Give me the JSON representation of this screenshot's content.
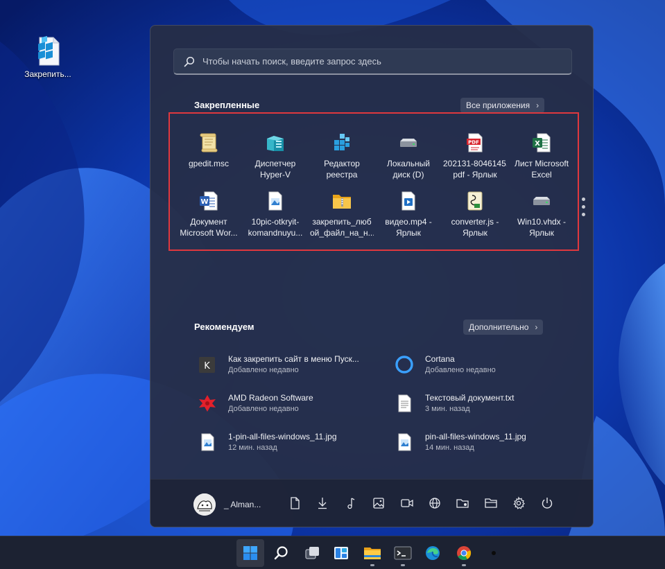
{
  "desktop": {
    "icons": [
      {
        "label": "Закрепить...",
        "icon": "registry-editor-icon"
      }
    ]
  },
  "start": {
    "search": {
      "placeholder": "Чтобы начать поиск, введите запрос здесь"
    },
    "pinned": {
      "title": "Закрепленные",
      "all_apps": "Все приложения",
      "apps": [
        {
          "line1": "gpedit.msc",
          "line2": "",
          "icon": "scroll-icon"
        },
        {
          "line1": "Диспетчер",
          "line2": "Hyper-V",
          "icon": "hyper-v-icon"
        },
        {
          "line1": "Редактор",
          "line2": "реестра",
          "icon": "registry-editor-icon"
        },
        {
          "line1": "Локальный",
          "line2": "диск (D)",
          "icon": "drive-icon"
        },
        {
          "line1": "202131-8046145.",
          "line2": "pdf - Ярлык",
          "icon": "pdf-icon"
        },
        {
          "line1": "Лист Microsoft",
          "line2": "Excel",
          "icon": "excel-icon"
        },
        {
          "line1": "Документ",
          "line2": "Microsoft Wor...",
          "icon": "word-icon"
        },
        {
          "line1": "10pic-otkryit-",
          "line2": "komandnuyu...",
          "icon": "image-file-icon"
        },
        {
          "line1": "закрепить_люб",
          "line2": "ой_файл_на_н...",
          "icon": "zip-folder-icon"
        },
        {
          "line1": "видео.mp4 -",
          "line2": "Ярлык",
          "icon": "video-file-icon"
        },
        {
          "line1": "converter.js -",
          "line2": "Ярлык",
          "icon": "script-file-icon"
        },
        {
          "line1": "Win10.vhdx -",
          "line2": "Ярлык",
          "icon": "drive-icon"
        }
      ]
    },
    "recommended": {
      "title": "Рекомендуем",
      "more": "Дополнительно",
      "items": [
        {
          "title": "Как закрепить сайт в меню Пуск...",
          "sub": "Добавлено недавно",
          "icon": "k-letter-icon"
        },
        {
          "title": "Cortana",
          "sub": "Добавлено недавно",
          "icon": "cortana-icon"
        },
        {
          "title": "AMD Radeon Software",
          "sub": "Добавлено недавно",
          "icon": "amd-radeon-icon"
        },
        {
          "title": "Текстовый документ.txt",
          "sub": "3 мин. назад",
          "icon": "text-file-icon"
        },
        {
          "title": "1-pin-all-files-windows_11.jpg",
          "sub": "12 мин. назад",
          "icon": "image-file-icon"
        },
        {
          "title": "pin-all-files-windows_11.jpg",
          "sub": "14 мин. назад",
          "icon": "image-file-icon"
        }
      ]
    },
    "user": {
      "name": "_ Alman..."
    },
    "bottom_icons": [
      "documents-icon",
      "downloads-icon",
      "music-icon",
      "pictures-icon",
      "videos-icon",
      "network-icon",
      "personal-folder-icon",
      "file-explorer-icon",
      "settings-icon",
      "power-icon"
    ]
  },
  "taskbar": {
    "items": [
      "start-icon",
      "search-icon",
      "task-view-icon",
      "widgets-icon",
      "file-explorer-icon",
      "terminal-icon",
      "edge-icon",
      "chrome-icon",
      "app-icon"
    ]
  },
  "colors": {
    "highlight_border": "#e0383e",
    "accent": "#0078d4"
  }
}
